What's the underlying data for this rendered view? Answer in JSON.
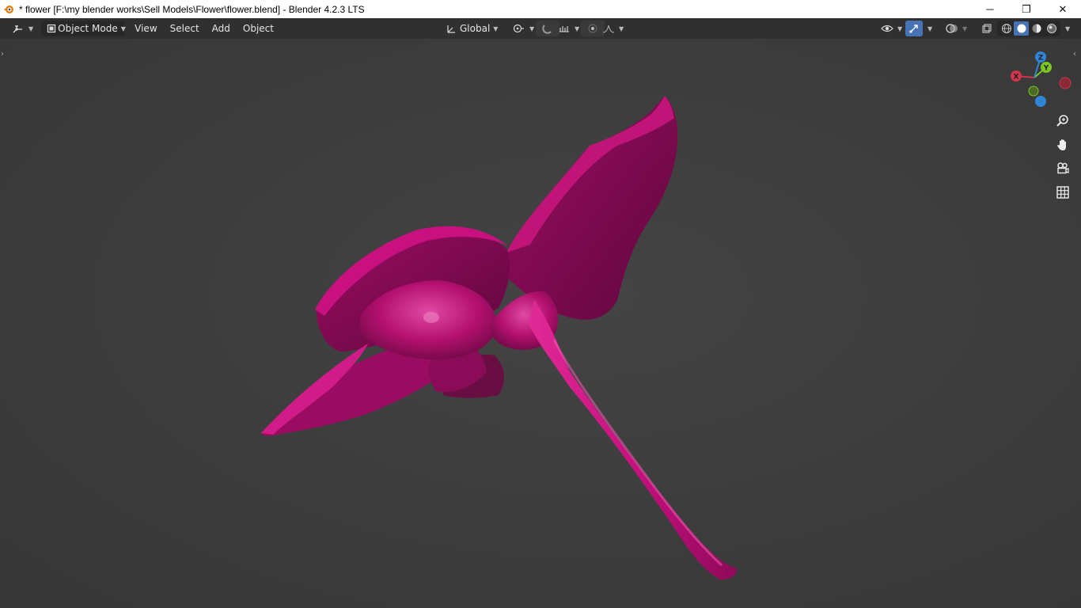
{
  "window": {
    "title": "* flower [F:\\my blender works\\Sell Models\\Flower\\flower.blend] - Blender 4.2.3 LTS",
    "minimize_glyph": "─",
    "maximize_glyph": "❐",
    "close_glyph": "✕"
  },
  "header": {
    "editor_type_icon": "viewport-icon",
    "mode_label": "Object Mode",
    "menus": [
      "View",
      "Select",
      "Add",
      "Object"
    ],
    "transform_orientation": "Global"
  },
  "gizmo": {
    "axis_x": "X",
    "axis_y": "Y",
    "axis_z": "Z"
  },
  "colors": {
    "flower": "#c8107f",
    "flower_dark": "#7a0a4c",
    "flower_light": "#e44aa4",
    "x_axis": "#d0354b",
    "y_axis": "#7bc621",
    "z_axis": "#2f86d6",
    "header_bg": "#303030",
    "viewport_bg": "#3d3d3d"
  }
}
